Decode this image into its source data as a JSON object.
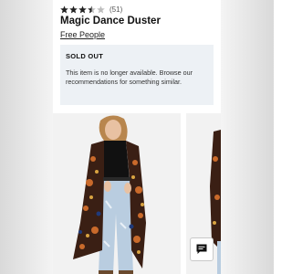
{
  "product": {
    "rating_value": 3.5,
    "rating_max": 5,
    "rating_count": "(51)",
    "title": "Magic Dance Duster",
    "brand": "Free People"
  },
  "soldout": {
    "title": "SOLD OUT",
    "message": "This item is no longer available. Browse our recommendations for something similar."
  },
  "icons": {
    "star": "star-icon",
    "chat": "chat-icon"
  },
  "colors": {
    "star_filled": "#222222",
    "star_empty": "#bdbdbd",
    "soldout_bg": "#edf1f5"
  }
}
